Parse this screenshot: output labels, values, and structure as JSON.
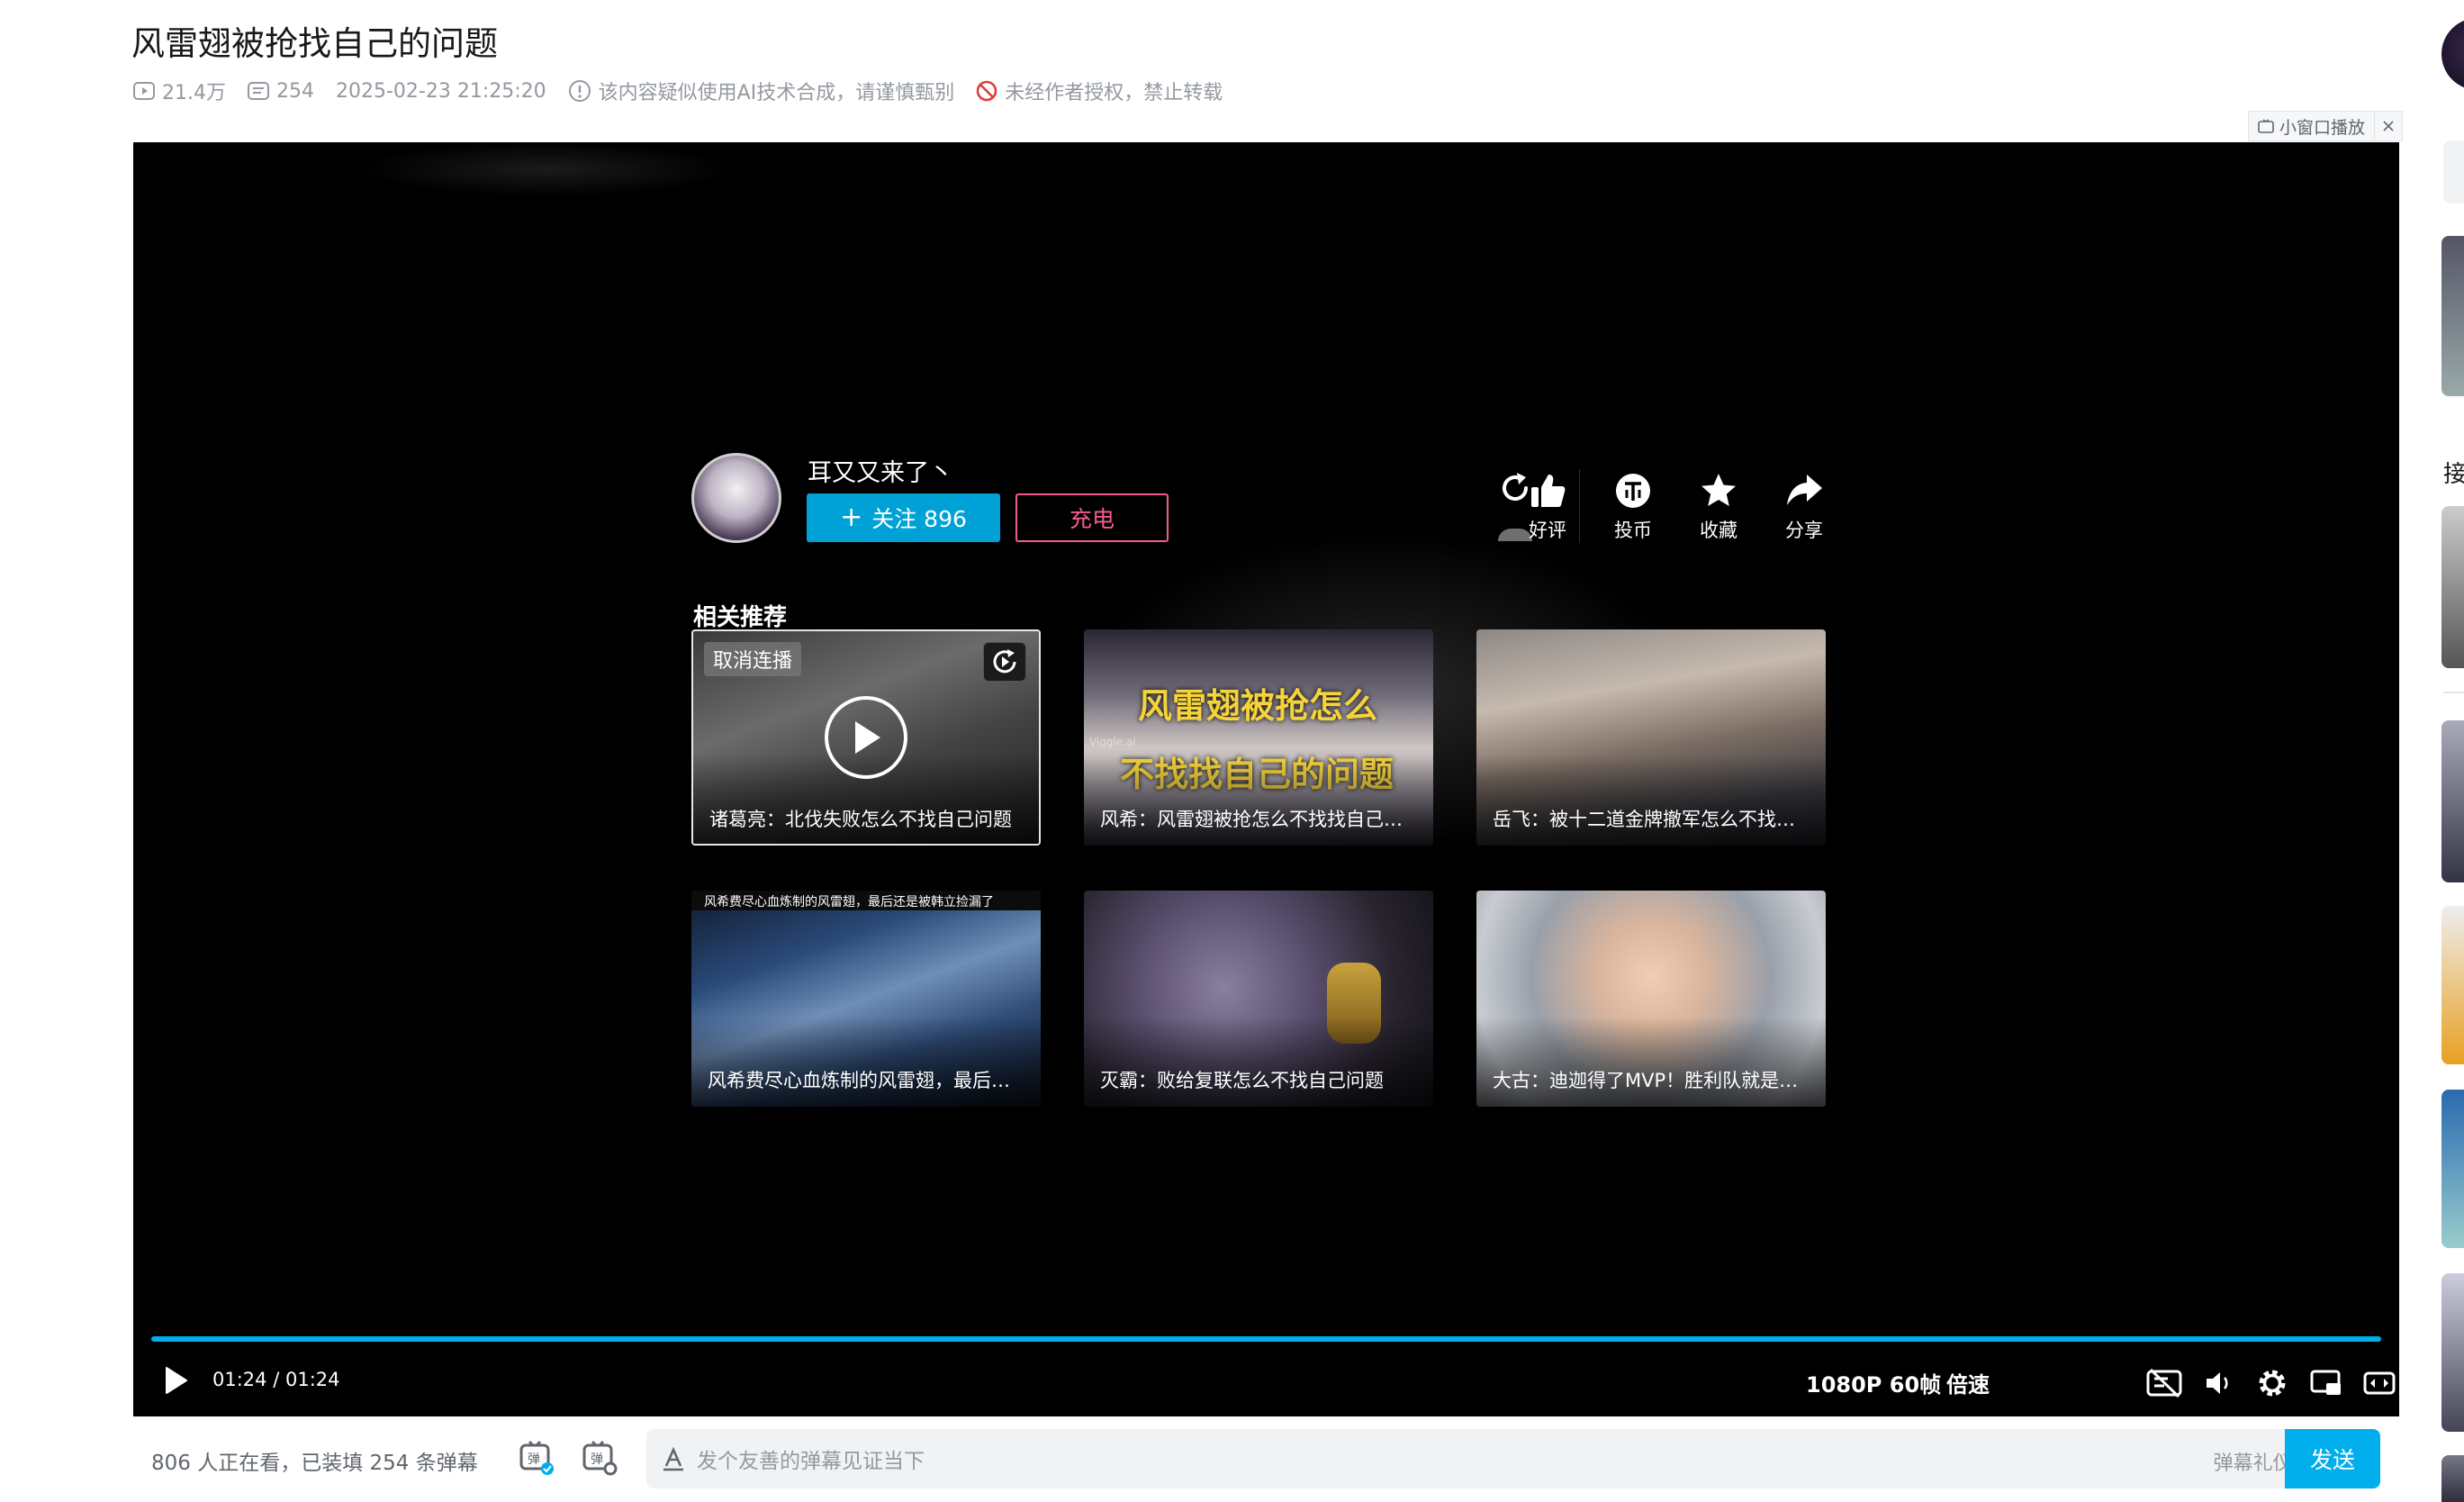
{
  "video": {
    "title": "风雷翅被抢找自己的问题",
    "views": "21.4万",
    "danmaku_count": "254",
    "publish_time": "2025-02-23 21:25:20",
    "ai_notice": "该内容疑似使用AI技术合成，请谨慎甄别",
    "repost_notice": "未经作者授权，禁止转载"
  },
  "mini_player": {
    "label": "小窗口播放"
  },
  "endcard": {
    "uploader": "耳又又来了丶",
    "follow_label": "关注 896",
    "charge_label": "充电",
    "actions": [
      {
        "label": "好评",
        "icon": "thumb-up-icon"
      },
      {
        "label": "投币",
        "icon": "coin-icon"
      },
      {
        "label": "收藏",
        "icon": "star-icon"
      },
      {
        "label": "分享",
        "icon": "share-icon"
      }
    ],
    "related_title": "相关推荐",
    "cancel_autoplay": "取消连播",
    "recommendations": [
      {
        "title": "诸葛亮：北伐失败怎么不找自己问题"
      },
      {
        "title": "风希：风雷翅被抢怎么不找找自己的问题",
        "overlay_line1": "风雷翅被抢怎么",
        "overlay_line2": "不找找自己的问题",
        "watermark": "Viggle.ai"
      },
      {
        "title": "岳飞：被十二道金牌撤军怎么不找找自己的问题"
      },
      {
        "title": "风希费尽心血炼制的风雷翅，最后还是被韩立捡漏了",
        "overlay_line1": "风希费尽心血炼制的风雷翅，最后还是被韩立捡漏了"
      },
      {
        "title": "灭霸：败给复联怎么不找自己问题"
      },
      {
        "title": "大古：迪迦得了MVP！胜利队就是摆设"
      }
    ]
  },
  "controls": {
    "progress_fraction": 1.0,
    "current_time": "01:24",
    "separator": "/",
    "duration": "01:24",
    "quality": "1080P 60帧",
    "speed": "倍速"
  },
  "danmaku_bar": {
    "status": "806 人正在看，已装填 254 条弹幕",
    "placeholder": "发个友善的弹幕见证当下",
    "etiquette": "弹幕礼仪 >",
    "send": "发送"
  },
  "sidebar": {
    "partial_text": "接"
  },
  "colors": {
    "accent": "#00aeec",
    "follow": "#00a1d6",
    "charge": "#f25d8e"
  }
}
